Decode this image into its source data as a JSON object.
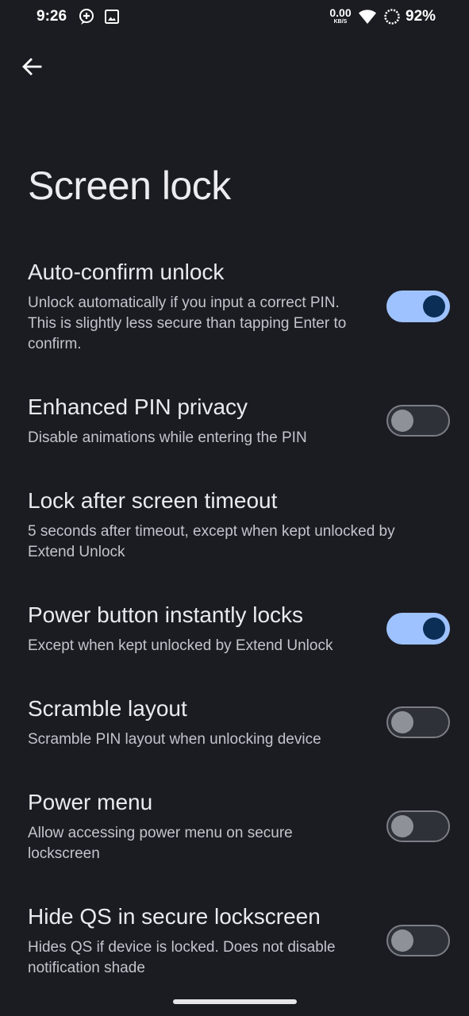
{
  "status_bar": {
    "time": "9:26",
    "net_speed_value": "0.00",
    "net_speed_unit": "KB/S",
    "battery_percent": "92%",
    "icons": [
      "assistant-icon",
      "image-icon",
      "wifi-icon",
      "battery-ring-icon"
    ]
  },
  "header": {
    "back_icon": "back-arrow-icon",
    "title": "Screen lock"
  },
  "settings": [
    {
      "title": "Auto-confirm unlock",
      "summary": "Unlock automatically if you input a correct PIN. This is slightly less secure than tapping Enter to confirm.",
      "toggle": true
    },
    {
      "title": "Enhanced PIN privacy",
      "summary": "Disable animations while entering the PIN",
      "toggle": false
    },
    {
      "title": "Lock after screen timeout",
      "summary": "5 seconds after timeout, except when kept unlocked by Extend Unlock"
    },
    {
      "title": "Power button instantly locks",
      "summary": "Except when kept unlocked by Extend Unlock",
      "toggle": true
    },
    {
      "title": "Scramble layout",
      "summary": "Scramble PIN layout when unlocking device",
      "toggle": false
    },
    {
      "title": "Power menu",
      "summary": "Allow accessing power menu on secure lockscreen",
      "toggle": false
    },
    {
      "title": "Hide QS in secure lockscreen",
      "summary": "Hides QS if device is locked. Does not disable notification shade",
      "toggle": false
    }
  ],
  "colors": {
    "background": "#1b1c22",
    "toggle_on_track": "#9ec2ff",
    "toggle_on_thumb": "#0b2e57",
    "toggle_off_track": "#2f3138",
    "toggle_off_thumb": "#8f9198"
  }
}
